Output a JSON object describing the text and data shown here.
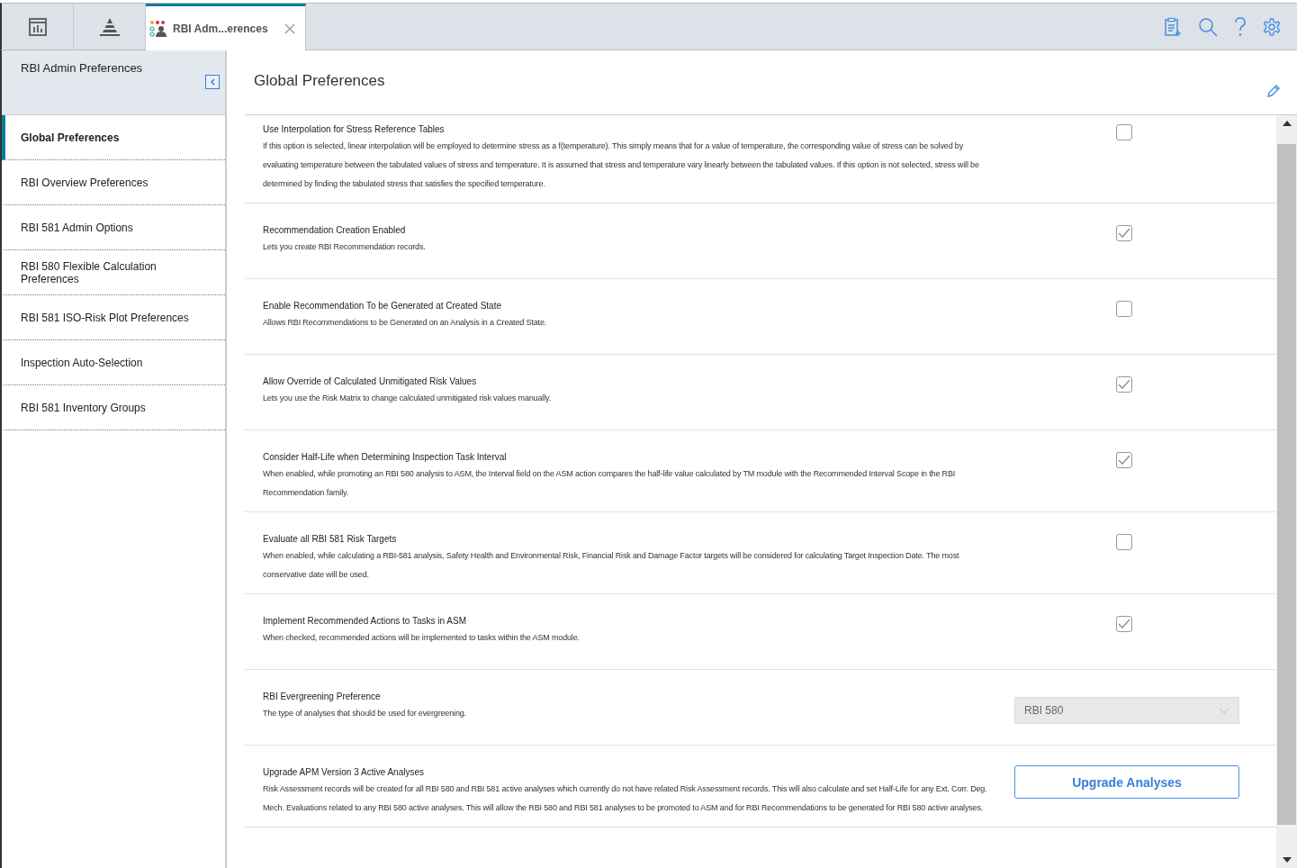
{
  "tabs": [
    {
      "kind": "dashboard",
      "selected": false
    },
    {
      "kind": "pyramid",
      "selected": false
    },
    {
      "kind": "page",
      "label": "RBI Adm...erences",
      "selected": true
    }
  ],
  "toolbar": [
    {
      "kind": "clipboard"
    },
    {
      "kind": "search"
    },
    {
      "kind": "help"
    },
    {
      "kind": "settings"
    }
  ],
  "sidebar": {
    "title": "RBI Admin Preferences",
    "items": [
      {
        "label": "Global Preferences",
        "selected": true
      },
      {
        "label": "RBI Overview Preferences",
        "selected": false
      },
      {
        "label": "RBI 581 Admin Options",
        "selected": false
      },
      {
        "label": "RBI 580 Flexible Calculation Preferences",
        "selected": false
      },
      {
        "label": "RBI 581 ISO-Risk Plot Preferences",
        "selected": false
      },
      {
        "label": "Inspection Auto-Selection",
        "selected": false
      },
      {
        "label": "RBI 581 Inventory Groups",
        "selected": false
      }
    ]
  },
  "main": {
    "title": "Global Preferences",
    "options": [
      {
        "kind": "checkbox",
        "title": "Use Interpolation for Stress Reference Tables",
        "description": "If this option is selected, linear interpolation will be employed to determine stress as a f(temperature). This simply means that for a value of temperature, the corresponding value of stress can be solved by evaluating temperature between the tabulated values of stress and temperature. It is assumed that stress and temperature vary linearly between the tabulated values. If this option is not selected, stress will be determined by finding the tabulated stress that satisfies the specified temperature.",
        "checked": false
      },
      {
        "kind": "checkbox",
        "title": "Recommendation Creation Enabled",
        "description": "Lets you create RBI Recommendation records.",
        "checked": true
      },
      {
        "kind": "checkbox",
        "title": "Enable Recommendation To be Generated at Created State",
        "description": "Allows RBI Recommendations to be Generated on an Analysis in a Created State.",
        "checked": false
      },
      {
        "kind": "checkbox",
        "title": "Allow Override of Calculated Unmitigated Risk Values",
        "description": "Lets you use the Risk Matrix to change calculated unmitigated risk values manually.",
        "checked": true
      },
      {
        "kind": "checkbox",
        "title": "Consider Half-Life when Determining Inspection Task Interval",
        "description": "When enabled, while promoting an RBI 580 analysis to ASM, the Interval field on the ASM action compares the half-life value calculated by TM module with the Recommended Interval Scope in the RBI Recommendation family.",
        "checked": true
      },
      {
        "kind": "checkbox",
        "title": "Evaluate all RBI 581 Risk Targets",
        "description": "When enabled, while calculating a RBI-581 analysis, Safety Health and Environmental Risk, Financial Risk and Damage Factor targets will be considered for calculating Target Inspection Date. The most conservative date will be used.",
        "checked": false
      },
      {
        "kind": "checkbox",
        "title": "Implement Recommended Actions to Tasks in ASM",
        "description": "When checked, recommended actions will be implemented to tasks within the ASM module.",
        "checked": true
      },
      {
        "kind": "dropdown",
        "title": "RBI Evergreening Preference",
        "description": "The type of analyses that should be used for evergreening.",
        "value": "RBI 580"
      },
      {
        "kind": "button",
        "title": "Upgrade APM Version 3 Active Analyses",
        "description": "Risk Assessment records will be created for all RBI 580 and RBI 581 active analyses which currently do not have related Risk Assessment records. This will also calculate and set Half-Life for any Ext. Corr. Deg. Mech. Evaluations related to any RBI 580 active analyses. This will allow the RBI 580 and RBI 581 analyses to be promoted to ASM and for RBI Recommendations to be generated for RBI 580 active analyses.",
        "button": "Upgrade Analyses"
      }
    ]
  }
}
